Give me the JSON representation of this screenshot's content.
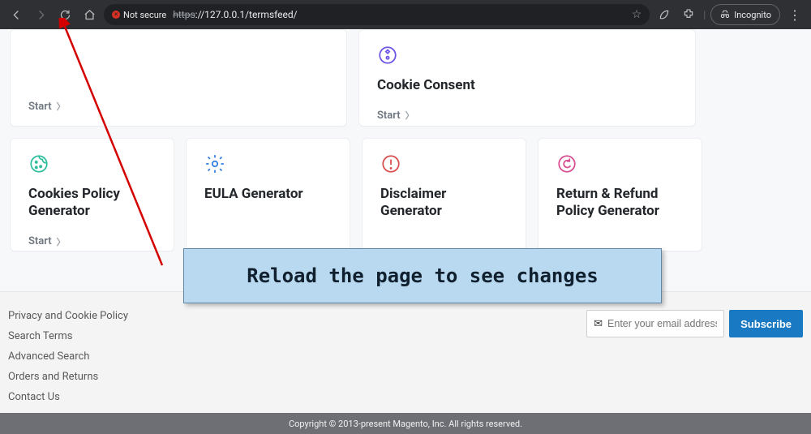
{
  "browser": {
    "security_label": "Not secure",
    "url_protocol": "https",
    "url_rest": "://127.0.0.1/termsfeed/",
    "incognito_label": "Incognito"
  },
  "row1": {
    "left": {
      "start_label": "Start"
    },
    "right": {
      "title": "Cookie Consent",
      "start_label": "Start"
    }
  },
  "cards": [
    {
      "title_line1": "Cookies Policy",
      "title_line2": "Generator",
      "start_label": "Start",
      "icon": "cookie"
    },
    {
      "title_line1": "EULA Generator",
      "title_line2": "",
      "icon": "gear"
    },
    {
      "title_line1": "Disclaimer",
      "title_line2": "Generator",
      "icon": "alert"
    },
    {
      "title_line1": "Return & Refund",
      "title_line2": "Policy Generator",
      "icon": "refund"
    }
  ],
  "callout": "Reload the page to see changes",
  "footer": {
    "links": [
      "Privacy and Cookie Policy",
      "Search Terms",
      "Advanced Search",
      "Orders and Returns",
      "Contact Us"
    ],
    "email_placeholder": "Enter your email address",
    "subscribe_label": "Subscribe",
    "copyright": "Copyright © 2013-present Magento, Inc. All rights reserved."
  }
}
